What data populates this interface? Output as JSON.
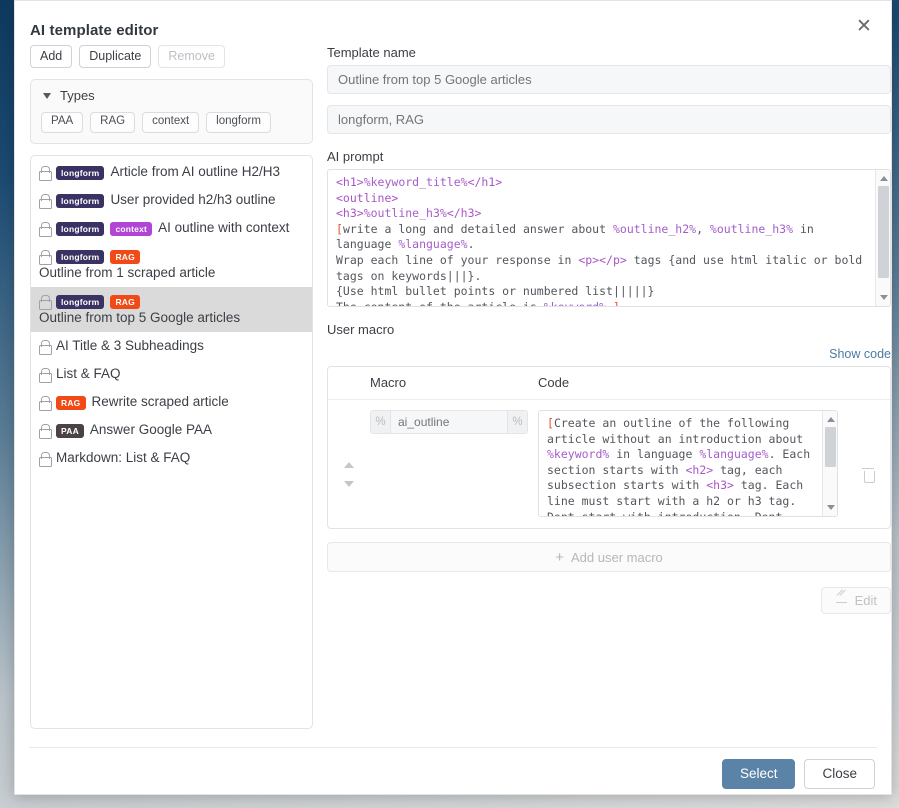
{
  "dialog": {
    "title": "AI template editor",
    "close_icon": "close-icon"
  },
  "toolbar": {
    "add_label": "Add",
    "duplicate_label": "Duplicate",
    "remove_label": "Remove"
  },
  "types_panel": {
    "header": "Types",
    "caret_icon": "chevron-down-icon",
    "chips": [
      "PAA",
      "RAG",
      "context",
      "longform"
    ]
  },
  "template_list": [
    {
      "lock": "lock-icon",
      "badges": [
        {
          "text": "longform",
          "kind": "longform"
        }
      ],
      "label": "Article from AI outline H2/H3",
      "selected": false
    },
    {
      "lock": "lock-icon",
      "badges": [
        {
          "text": "longform",
          "kind": "longform"
        }
      ],
      "label": "User provided h2/h3 outline",
      "selected": false
    },
    {
      "lock": "lock-icon",
      "badges": [
        {
          "text": "longform",
          "kind": "longform"
        },
        {
          "text": "context",
          "kind": "context"
        }
      ],
      "label": "AI outline with context",
      "selected": false
    },
    {
      "lock": "lock-icon",
      "badges": [
        {
          "text": "longform",
          "kind": "longform"
        },
        {
          "text": "RAG",
          "kind": "rag"
        }
      ],
      "label": "Outline from 1 scraped article",
      "selected": false
    },
    {
      "lock": "lock-icon",
      "badges": [
        {
          "text": "longform",
          "kind": "longform"
        },
        {
          "text": "RAG",
          "kind": "rag"
        }
      ],
      "label": "Outline from top 5 Google articles",
      "selected": true
    },
    {
      "lock": "lock-icon",
      "badges": [],
      "label": "AI Title & 3 Subheadings",
      "selected": false
    },
    {
      "lock": "lock-icon",
      "badges": [],
      "label": "List & FAQ",
      "selected": false
    },
    {
      "lock": "lock-icon",
      "badges": [
        {
          "text": "RAG",
          "kind": "rag"
        }
      ],
      "label": "Rewrite scraped article",
      "selected": false
    },
    {
      "lock": "lock-icon",
      "badges": [
        {
          "text": "PAA",
          "kind": "paa"
        }
      ],
      "label": "Answer Google PAA",
      "selected": false
    },
    {
      "lock": "lock-icon",
      "badges": [],
      "label": "Markdown: List & FAQ",
      "selected": false
    }
  ],
  "template_name": {
    "label": "Template name",
    "value": "Outline from top 5 Google articles",
    "placeholder": "Outline from top 5 Google articles"
  },
  "template_tags": {
    "value": "longform, RAG",
    "placeholder": "longform, RAG"
  },
  "ai_prompt": {
    "label": "AI prompt",
    "text": "<h1>%keyword_title%</h1>\n<outline>\n<h3>%outline_h3%</h3>\n[write a long and detailed answer about %outline_h2%, %outline_h3% in language %language%.\nWrap each line of your response in <p></p> tags {and use html italic or bold tags on keywords|||}.\n{Use html bullet points or numbered list|||||}\nThe content of the article is %keyword% ]",
    "scroll_up_icon": "scroll-up-arrow-icon",
    "scroll_down_icon": "scroll-down-arrow-icon"
  },
  "user_macro": {
    "label": "User macro",
    "show_code_label": "Show code",
    "columns": [
      "Macro",
      "Code"
    ],
    "rows": [
      {
        "macro_name": "ai_outline",
        "macro_placeholder": "ai_outline",
        "percent_left": "%",
        "percent_right": "%",
        "code": "[Create an outline of the following article without an introduction about %keyword% in language %language%. Each section starts with <h2> tag, each subsection starts with <h3> tag. Each line must start with a h2 or h3 tag. Dont start with introduction. Dont reference or explain yourself",
        "move_up_icon": "move-up-arrow-icon",
        "move_down_icon": "move-down-arrow-icon",
        "delete_icon": "trash-icon"
      }
    ],
    "add_label": "Add user macro",
    "add_icon": "plus-icon",
    "edit_label": "Edit",
    "edit_icon": "pencil-icon"
  },
  "footer": {
    "select_label": "Select",
    "close_label": "Close"
  },
  "colors": {
    "badge_longform": "#3b3264",
    "badge_context": "#b245d6",
    "badge_rag": "#f24a16",
    "badge_paa": "#4b4244",
    "primary_button": "#5b83a8",
    "link": "#4b7ba6",
    "selected_row": "#dadada"
  }
}
